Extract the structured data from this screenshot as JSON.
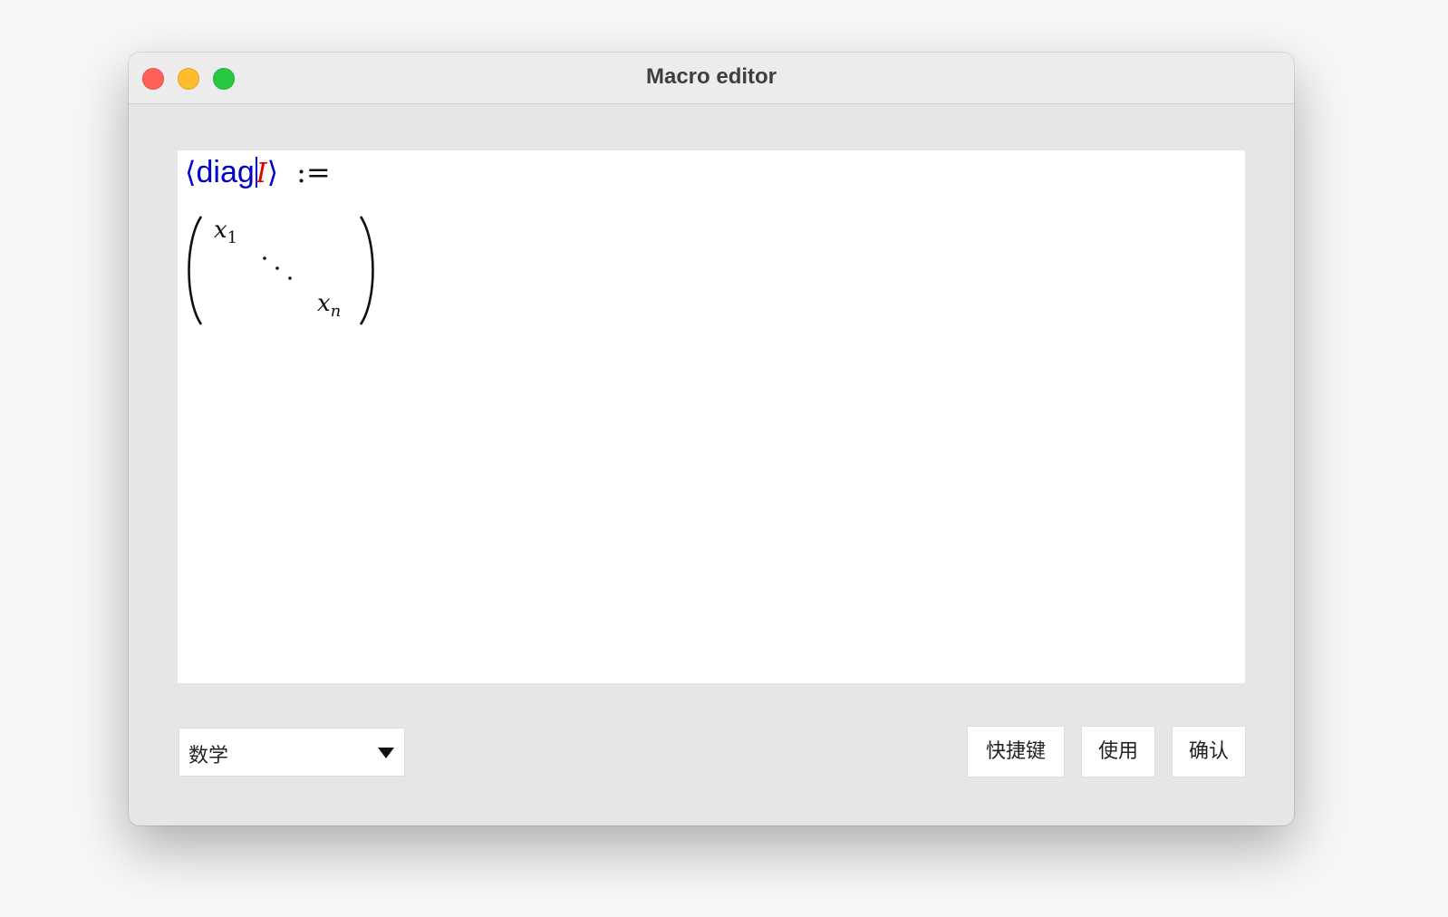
{
  "window": {
    "title": "Macro editor"
  },
  "editor": {
    "macro_name": "diag",
    "open_bracket": "⟨",
    "close_bracket": "⟩",
    "hole_marker": "I",
    "assign_symbol": ":=",
    "matrix": {
      "top_left_base": "x",
      "top_left_sub": "1",
      "bottom_right_base": "x",
      "bottom_right_sub": "n"
    }
  },
  "footer": {
    "mode_select_value": "数学",
    "buttons": {
      "shortcut": "快捷键",
      "apply": "使用",
      "confirm": "确认"
    }
  }
}
